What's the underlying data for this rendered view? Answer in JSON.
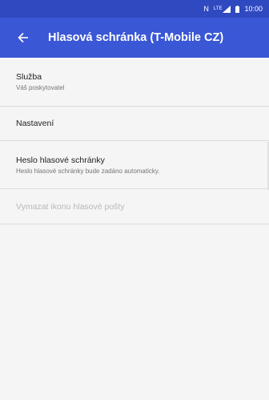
{
  "status_bar": {
    "network": "N",
    "signal_label": "LTE",
    "time": "10:00"
  },
  "app_bar": {
    "back_icon": "arrow-left-icon",
    "title": "Hlasová schránka (T-Mobile CZ)"
  },
  "settings": {
    "items": [
      {
        "title": "Služba",
        "summary": "Váš poskytovatel",
        "enabled": true
      },
      {
        "title": "Nastavení",
        "summary": "",
        "enabled": true
      },
      {
        "title": "Heslo hlasové schránky",
        "summary": "Heslo hlasové schránky bude zadáno automaticky.",
        "enabled": true
      },
      {
        "title": "Vymazat ikonu hlasové pošty",
        "summary": "",
        "enabled": false
      }
    ]
  },
  "colors": {
    "status_bar": "#2f49c0",
    "app_bar": "#3a57d6",
    "background": "#f5f5f5"
  }
}
